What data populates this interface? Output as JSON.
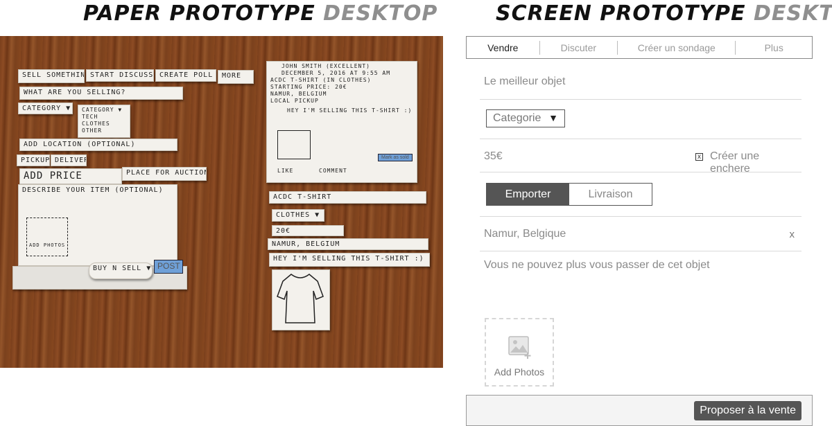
{
  "headings": {
    "paper": {
      "dark": "PAPER PROTOTYPE",
      "light": "DESKTOP"
    },
    "screen": {
      "dark": "SCREEN PROTOTYPE",
      "light": "DESKTOP"
    }
  },
  "paper_prototype": {
    "tabs": [
      "Sell something",
      "Start discussion",
      "Create poll",
      "More"
    ],
    "question": "What are you selling?",
    "category": "Category ▼",
    "category_options": [
      "Tech",
      "Clothes",
      "Other"
    ],
    "add_location": "Add location (optional)",
    "pickup": "Pickup",
    "delivery": "Delivery",
    "add_price": "Add price",
    "auction": "Place for auction",
    "describe": "Describe your item (optional)",
    "add_photos": "Add photos",
    "buy_n_sell": "Buy n Sell ▼",
    "post": "POST",
    "post_author": "John Smith (excellent)",
    "post_date": "December 5, 2016 at 9:55 AM",
    "post_title": "ACDC T-shirt (in clothes)",
    "post_price": "Starting price: 20€",
    "post_location": "Namur, Belgium",
    "post_pickup": "Local pickup",
    "post_desc": "Hey I'm selling this T-shirt :)",
    "mark_sold": "Mark as sold",
    "like": "Like",
    "comment": "Comment",
    "strip_title": "ACDC T-shirt",
    "strip_category": "Clothes ▼",
    "strip_price": "20€",
    "strip_location": "Namur, Belgium",
    "strip_desc": "Hey I'm selling this T-shirt :)"
  },
  "screen_prototype": {
    "tabs": [
      {
        "label": "Vendre",
        "active": true
      },
      {
        "label": "Discuter",
        "active": false
      },
      {
        "label": "Créer un sondage",
        "active": false
      },
      {
        "label": "Plus",
        "active": false
      }
    ],
    "title_placeholder": "Le meilleur objet",
    "category_label": "Categorie",
    "category_arrow": "▼",
    "price_value": "35€",
    "auction_checked": true,
    "auction_mark": "x",
    "auction_label": "Créer une enchere",
    "delivery_options": [
      "Emporter",
      "Livraison"
    ],
    "delivery_selected": "Emporter",
    "location_value": "Namur, Belgique",
    "location_clear": "x",
    "description_placeholder": "Vous ne pouvez plus vous passer de cet objet",
    "add_photos_label": "Add Photos",
    "submit_label": "Proposer à la vente"
  }
}
